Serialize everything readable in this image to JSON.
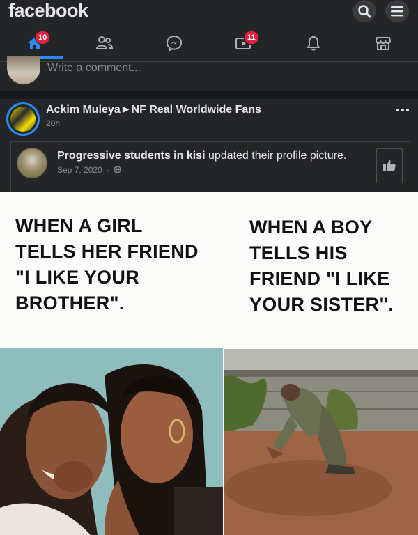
{
  "app": {
    "brand": "facebook"
  },
  "header_icons": {
    "search": "search-icon",
    "menu": "menu-icon"
  },
  "nav": {
    "items": [
      {
        "name": "home",
        "icon": "home-icon",
        "badge": "10",
        "active": true
      },
      {
        "name": "friends",
        "icon": "friends-icon",
        "badge": ""
      },
      {
        "name": "messenger",
        "icon": "messenger-icon",
        "badge": ""
      },
      {
        "name": "watch",
        "icon": "watch-icon",
        "badge": "11"
      },
      {
        "name": "notifications",
        "icon": "bell-icon",
        "badge": ""
      },
      {
        "name": "marketplace",
        "icon": "marketplace-icon",
        "badge": ""
      }
    ]
  },
  "comment": {
    "placeholder": "Write a comment..."
  },
  "post": {
    "author": "Ackim Muleya►NF Real Worldwide Fans",
    "time": "20h",
    "shared": {
      "page": "Progressive students in kisi",
      "action": " updated their profile picture.",
      "date": "Sep 7, 2020",
      "separator": "·"
    }
  },
  "meme": {
    "left_caption": "WHEN A GIRL\nTELLS HER FRIEND\n\"I LIKE YOUR\nBROTHER\".",
    "right_caption": "WHEN A BOY\nTELLS HIS\nFRIEND \"I LIKE\nYOUR SISTER\"."
  },
  "colors": {
    "background": "#18191a",
    "surface": "#242526",
    "accent": "#2d88ff",
    "badge": "#e41e3f",
    "text": "#e4e6eb",
    "muted": "#8a8d91"
  }
}
